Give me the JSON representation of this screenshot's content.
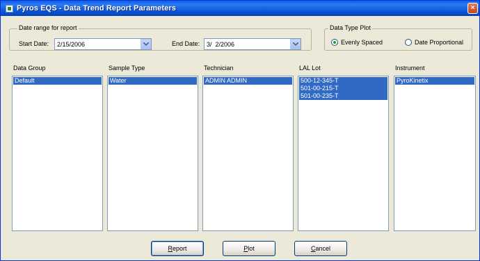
{
  "window": {
    "title": "Pyros EQS - Data Trend Report Parameters",
    "close_glyph": "×"
  },
  "date_range": {
    "legend": "Date range for report",
    "start_label": "Start Date:",
    "start_value": "2/15/2006",
    "end_label": "End Date:",
    "end_value": "3/  2/2006"
  },
  "plot_type": {
    "legend": "Data Type Plot",
    "options": [
      {
        "label": "Evenly Spaced",
        "selected": true
      },
      {
        "label": "Date Proportional",
        "selected": false
      }
    ]
  },
  "lists": [
    {
      "label": "Data Group",
      "items": [
        {
          "text": "Default",
          "selected": true
        }
      ]
    },
    {
      "label": "Sample Type",
      "items": [
        {
          "text": "Water",
          "selected": true
        }
      ]
    },
    {
      "label": "Technician",
      "items": [
        {
          "text": "ADMIN ADMIN",
          "selected": true
        }
      ]
    },
    {
      "label": "LAL Lot",
      "items": [
        {
          "text": "500-12-345-T",
          "selected": true
        },
        {
          "text": "501-00-215-T",
          "selected": true
        },
        {
          "text": "501-00-235-T",
          "selected": true
        }
      ]
    },
    {
      "label": "Instrument",
      "items": [
        {
          "text": "PyroKinetix",
          "selected": true
        }
      ]
    }
  ],
  "buttons": {
    "report": {
      "first": "R",
      "rest": "eport"
    },
    "plot": {
      "first": "P",
      "rest": "lot"
    },
    "cancel": {
      "first": "C",
      "rest": "ancel"
    }
  },
  "colors": {
    "selection": "#316ac5",
    "titlebar": "#0a5fe8",
    "dialog_bg": "#ece9d8"
  }
}
